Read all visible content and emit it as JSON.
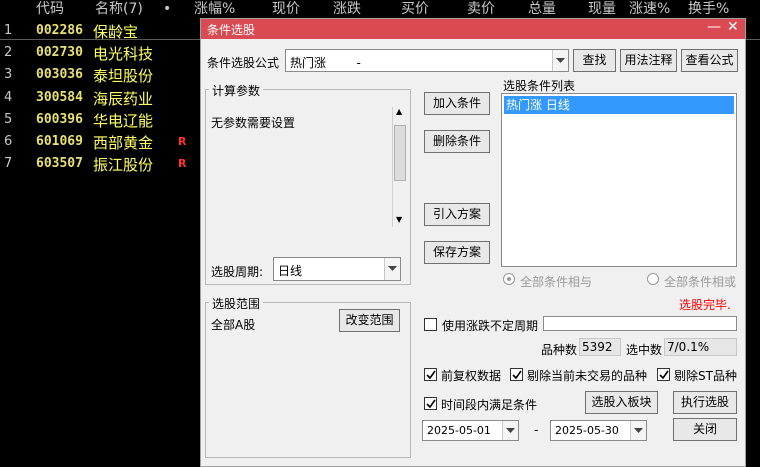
{
  "columns": [
    "代码",
    "名称(7)",
    "•",
    "涨幅%",
    "现价",
    "涨跌",
    "买价",
    "卖价",
    "总量",
    "现量",
    "涨速%",
    "换手%"
  ],
  "stocks": [
    {
      "idx": "1",
      "code": "002286",
      "name": "保龄宝",
      "flag": ""
    },
    {
      "idx": "2",
      "code": "002730",
      "name": "电光科技",
      "flag": ""
    },
    {
      "idx": "3",
      "code": "003036",
      "name": "泰坦股份",
      "flag": ""
    },
    {
      "idx": "4",
      "code": "300584",
      "name": "海辰药业",
      "flag": ""
    },
    {
      "idx": "5",
      "code": "600396",
      "name": "华电辽能",
      "flag": ""
    },
    {
      "idx": "6",
      "code": "601069",
      "name": "西部黄金",
      "flag": "R"
    },
    {
      "idx": "7",
      "code": "603507",
      "name": "振江股份",
      "flag": "R"
    }
  ],
  "dialog": {
    "title": "条件选股",
    "formula_label": "条件选股公式",
    "formula_value": "热门涨        -",
    "find_button": "查找",
    "usage_button": "用法注释",
    "view_button": "查看公式",
    "params_group": "计算参数",
    "params_text": "无参数需要设置",
    "period_label": "选股周期:",
    "period_value": "日线",
    "add_button": "加入条件",
    "delete_button": "删除条件",
    "import_button": "引入方案",
    "save_button": "保存方案",
    "list_label": "选股条件列表",
    "list_items": [
      "热门涨  日线"
    ],
    "radio_and": "全部条件相与",
    "radio_or": "全部条件相或",
    "status": "选股完毕.",
    "scope_group": "选股范围",
    "scope_text": "全部A股",
    "change_scope_button": "改变范围",
    "uncertain_period_label": "使用涨跌不定周期",
    "count_label": "品种数",
    "count_value": "5392",
    "selected_label": "选中数",
    "selected_value": "7/0.1%",
    "opt_adjust": "前复权数据",
    "opt_exclude_untraded": "剔除当前未交易的品种",
    "opt_exclude_st": "剔除ST品种",
    "opt_time_range": "时间段内满足条件",
    "to_block_button": "选股入板块",
    "run_button": "执行选股",
    "date_from": "2025-05-01",
    "date_sep": "-",
    "date_to": "2025-05-30",
    "close_button": "关闭",
    "status_color": "#ff0000",
    "title_color": "#d94a52",
    "selection_color": "#3399ff"
  }
}
